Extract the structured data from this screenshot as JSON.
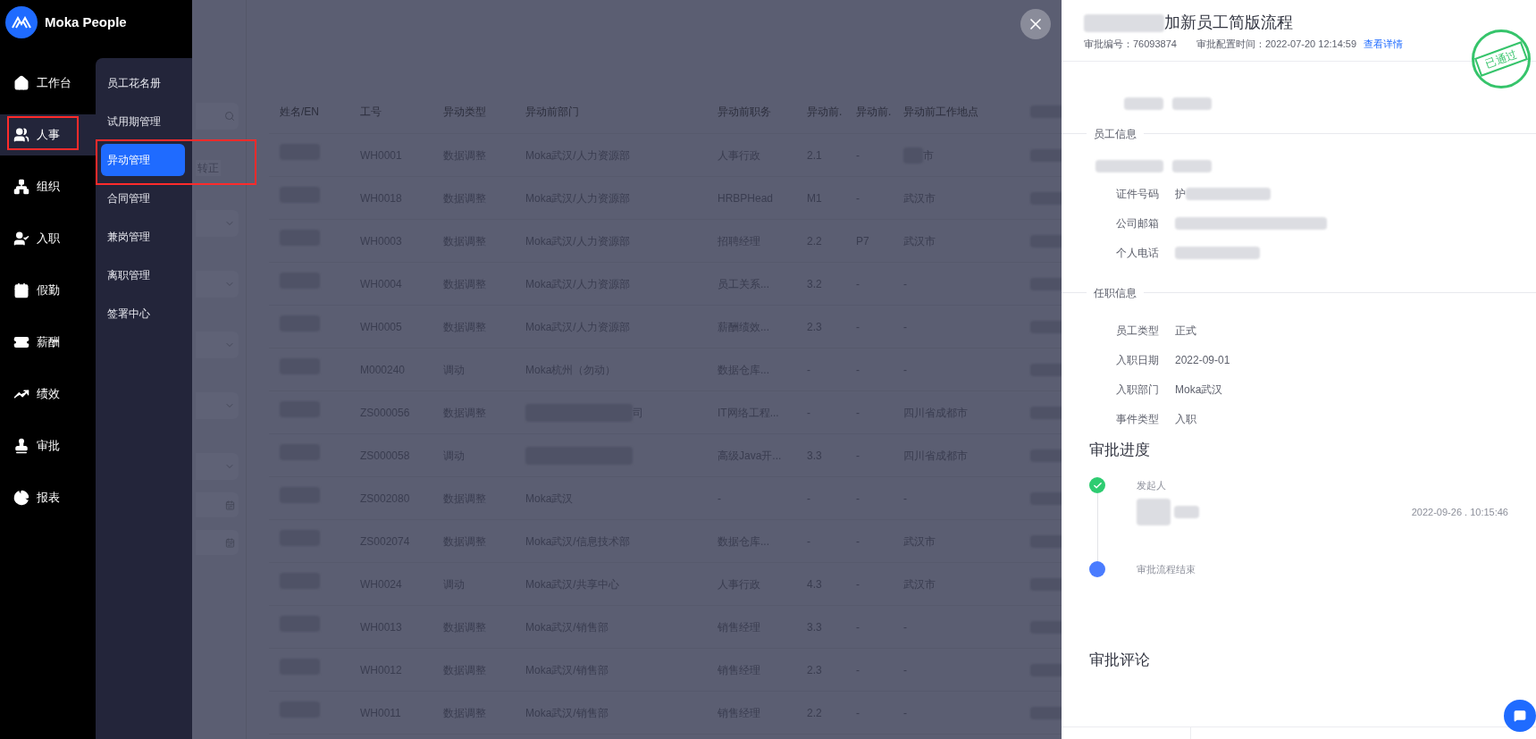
{
  "brand": {
    "name": "Moka People"
  },
  "nav": [
    {
      "label": "工作台",
      "selected": false
    },
    {
      "label": "人事",
      "selected": true
    },
    {
      "label": "组织",
      "selected": false
    },
    {
      "label": "入职",
      "selected": false
    },
    {
      "label": "假勤",
      "selected": false
    },
    {
      "label": "薪酬",
      "selected": false
    },
    {
      "label": "绩效",
      "selected": false
    },
    {
      "label": "审批",
      "selected": false
    },
    {
      "label": "报表",
      "selected": false
    }
  ],
  "submenu": [
    {
      "label": "员工花名册",
      "selected": false
    },
    {
      "label": "试用期管理",
      "selected": false
    },
    {
      "label": "异动管理",
      "selected": true
    },
    {
      "label": "合同管理",
      "selected": false
    },
    {
      "label": "兼岗管理",
      "selected": false
    },
    {
      "label": "离职管理",
      "selected": false
    },
    {
      "label": "签署中心",
      "selected": false
    }
  ],
  "filters": {
    "tag": "转正"
  },
  "table": {
    "columns": [
      "姓名/EN",
      "工号",
      "异动类型",
      "异动前部门",
      "异动前职务",
      "异动前.",
      "异动前.",
      "异动前工作地点"
    ],
    "rows": [
      {
        "id": "WH0001",
        "type": "数据调整",
        "dept": "Moka武汉/人力资源部",
        "title": "人事行政",
        "c1": "2.1",
        "c2": "-",
        "location": "市",
        "location_redacted": true
      },
      {
        "id": "WH0018",
        "type": "数据调整",
        "dept": "Moka武汉/人力资源部",
        "title": "HRBPHead",
        "c1": "M1",
        "c2": "-",
        "location": "武汉市"
      },
      {
        "id": "WH0003",
        "type": "数据调整",
        "dept": "Moka武汉/人力资源部",
        "title": "招聘经理",
        "c1": "2.2",
        "c2": "P7",
        "location": "武汉市"
      },
      {
        "id": "WH0004",
        "type": "数据调整",
        "dept": "Moka武汉/人力资源部",
        "title": "员工关系...",
        "c1": "3.2",
        "c2": "-",
        "location": "-"
      },
      {
        "id": "WH0005",
        "type": "数据调整",
        "dept": "Moka武汉/人力资源部",
        "title": "薪酬绩效...",
        "c1": "2.3",
        "c2": "-",
        "location": "-"
      },
      {
        "id": "M000240",
        "type": "调动",
        "dept": "Moka杭州（勿动）",
        "title": "数据仓库...",
        "c1": "-",
        "c2": "-",
        "location": "-"
      },
      {
        "id": "ZS000056",
        "type": "数据调整",
        "dept": "司",
        "dept_redacted": true,
        "title": "IT网络工程...",
        "c1": "-",
        "c2": "-",
        "location": "四川省成都市"
      },
      {
        "id": "ZS000058",
        "type": "调动",
        "dept_redacted": true,
        "title": "高级Java开...",
        "c1": "3.3",
        "c2": "-",
        "location": "四川省成都市"
      },
      {
        "id": "ZS002080",
        "type": "数据调整",
        "dept": "Moka武汉",
        "title": "-",
        "c1": "-",
        "c2": "-",
        "location": "-"
      },
      {
        "id": "ZS002074",
        "type": "数据调整",
        "dept": "Moka武汉/信息技术部",
        "title": "数据仓库...",
        "c1": "-",
        "c2": "-",
        "location": "武汉市"
      },
      {
        "id": "WH0024",
        "type": "调动",
        "dept": "Moka武汉/共享中心",
        "title": "人事行政",
        "c1": "4.3",
        "c2": "-",
        "location": "武汉市"
      },
      {
        "id": "WH0013",
        "type": "数据调整",
        "dept": "Moka武汉/销售部",
        "title": "销售经理",
        "c1": "3.3",
        "c2": "-",
        "location": "-"
      },
      {
        "id": "WH0012",
        "type": "数据调整",
        "dept": "Moka武汉/销售部",
        "title": "销售经理",
        "c1": "2.3",
        "c2": "-",
        "location": "-"
      },
      {
        "id": "WH0011",
        "type": "数据调整",
        "dept": "Moka武汉/销售部",
        "title": "销售经理",
        "c1": "2.2",
        "c2": "-",
        "location": "-"
      }
    ]
  },
  "drawer": {
    "title": "加新员工简版流程",
    "approval_no": "审批编号：76093874",
    "config_time": "审批配置时间：2022-07-20 12:14:59",
    "detail_link": "查看详情",
    "stamp": "已通过",
    "sections": [
      {
        "heading": "员工信息",
        "fields": [
          {
            "label": "证件号码",
            "value": "护",
            "redacted": true
          },
          {
            "label": "公司邮箱",
            "redacted": true
          },
          {
            "label": "个人电话",
            "redacted": true
          }
        ]
      },
      {
        "heading": "任职信息",
        "fields": [
          {
            "label": "员工类型",
            "value": "正式"
          },
          {
            "label": "入职日期",
            "value": "2022-09-01"
          },
          {
            "label": "入职部门",
            "value": "Moka武汉"
          },
          {
            "label": "事件类型",
            "value": "入职"
          }
        ]
      }
    ],
    "progress": {
      "heading": "审批进度",
      "steps": [
        {
          "label": "发起人",
          "kind": "done",
          "time": "2022-09-26 . 10:15:46"
        },
        {
          "label": "审批流程结束",
          "kind": "current"
        }
      ]
    },
    "comments": {
      "heading": "审批评论"
    }
  }
}
